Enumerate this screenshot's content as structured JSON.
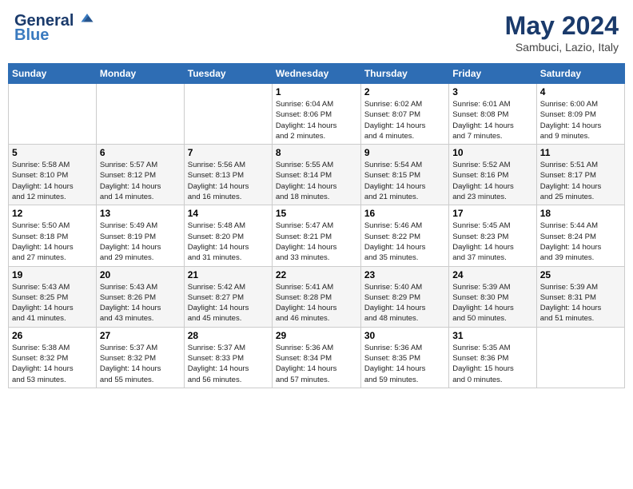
{
  "header": {
    "logo_line1": "General",
    "logo_line2": "Blue",
    "month_title": "May 2024",
    "location": "Sambuci, Lazio, Italy"
  },
  "days_of_week": [
    "Sunday",
    "Monday",
    "Tuesday",
    "Wednesday",
    "Thursday",
    "Friday",
    "Saturday"
  ],
  "weeks": [
    [
      {
        "num": "",
        "info": ""
      },
      {
        "num": "",
        "info": ""
      },
      {
        "num": "",
        "info": ""
      },
      {
        "num": "1",
        "info": "Sunrise: 6:04 AM\nSunset: 8:06 PM\nDaylight: 14 hours\nand 2 minutes."
      },
      {
        "num": "2",
        "info": "Sunrise: 6:02 AM\nSunset: 8:07 PM\nDaylight: 14 hours\nand 4 minutes."
      },
      {
        "num": "3",
        "info": "Sunrise: 6:01 AM\nSunset: 8:08 PM\nDaylight: 14 hours\nand 7 minutes."
      },
      {
        "num": "4",
        "info": "Sunrise: 6:00 AM\nSunset: 8:09 PM\nDaylight: 14 hours\nand 9 minutes."
      }
    ],
    [
      {
        "num": "5",
        "info": "Sunrise: 5:58 AM\nSunset: 8:10 PM\nDaylight: 14 hours\nand 12 minutes."
      },
      {
        "num": "6",
        "info": "Sunrise: 5:57 AM\nSunset: 8:12 PM\nDaylight: 14 hours\nand 14 minutes."
      },
      {
        "num": "7",
        "info": "Sunrise: 5:56 AM\nSunset: 8:13 PM\nDaylight: 14 hours\nand 16 minutes."
      },
      {
        "num": "8",
        "info": "Sunrise: 5:55 AM\nSunset: 8:14 PM\nDaylight: 14 hours\nand 18 minutes."
      },
      {
        "num": "9",
        "info": "Sunrise: 5:54 AM\nSunset: 8:15 PM\nDaylight: 14 hours\nand 21 minutes."
      },
      {
        "num": "10",
        "info": "Sunrise: 5:52 AM\nSunset: 8:16 PM\nDaylight: 14 hours\nand 23 minutes."
      },
      {
        "num": "11",
        "info": "Sunrise: 5:51 AM\nSunset: 8:17 PM\nDaylight: 14 hours\nand 25 minutes."
      }
    ],
    [
      {
        "num": "12",
        "info": "Sunrise: 5:50 AM\nSunset: 8:18 PM\nDaylight: 14 hours\nand 27 minutes."
      },
      {
        "num": "13",
        "info": "Sunrise: 5:49 AM\nSunset: 8:19 PM\nDaylight: 14 hours\nand 29 minutes."
      },
      {
        "num": "14",
        "info": "Sunrise: 5:48 AM\nSunset: 8:20 PM\nDaylight: 14 hours\nand 31 minutes."
      },
      {
        "num": "15",
        "info": "Sunrise: 5:47 AM\nSunset: 8:21 PM\nDaylight: 14 hours\nand 33 minutes."
      },
      {
        "num": "16",
        "info": "Sunrise: 5:46 AM\nSunset: 8:22 PM\nDaylight: 14 hours\nand 35 minutes."
      },
      {
        "num": "17",
        "info": "Sunrise: 5:45 AM\nSunset: 8:23 PM\nDaylight: 14 hours\nand 37 minutes."
      },
      {
        "num": "18",
        "info": "Sunrise: 5:44 AM\nSunset: 8:24 PM\nDaylight: 14 hours\nand 39 minutes."
      }
    ],
    [
      {
        "num": "19",
        "info": "Sunrise: 5:43 AM\nSunset: 8:25 PM\nDaylight: 14 hours\nand 41 minutes."
      },
      {
        "num": "20",
        "info": "Sunrise: 5:43 AM\nSunset: 8:26 PM\nDaylight: 14 hours\nand 43 minutes."
      },
      {
        "num": "21",
        "info": "Sunrise: 5:42 AM\nSunset: 8:27 PM\nDaylight: 14 hours\nand 45 minutes."
      },
      {
        "num": "22",
        "info": "Sunrise: 5:41 AM\nSunset: 8:28 PM\nDaylight: 14 hours\nand 46 minutes."
      },
      {
        "num": "23",
        "info": "Sunrise: 5:40 AM\nSunset: 8:29 PM\nDaylight: 14 hours\nand 48 minutes."
      },
      {
        "num": "24",
        "info": "Sunrise: 5:39 AM\nSunset: 8:30 PM\nDaylight: 14 hours\nand 50 minutes."
      },
      {
        "num": "25",
        "info": "Sunrise: 5:39 AM\nSunset: 8:31 PM\nDaylight: 14 hours\nand 51 minutes."
      }
    ],
    [
      {
        "num": "26",
        "info": "Sunrise: 5:38 AM\nSunset: 8:32 PM\nDaylight: 14 hours\nand 53 minutes."
      },
      {
        "num": "27",
        "info": "Sunrise: 5:37 AM\nSunset: 8:32 PM\nDaylight: 14 hours\nand 55 minutes."
      },
      {
        "num": "28",
        "info": "Sunrise: 5:37 AM\nSunset: 8:33 PM\nDaylight: 14 hours\nand 56 minutes."
      },
      {
        "num": "29",
        "info": "Sunrise: 5:36 AM\nSunset: 8:34 PM\nDaylight: 14 hours\nand 57 minutes."
      },
      {
        "num": "30",
        "info": "Sunrise: 5:36 AM\nSunset: 8:35 PM\nDaylight: 14 hours\nand 59 minutes."
      },
      {
        "num": "31",
        "info": "Sunrise: 5:35 AM\nSunset: 8:36 PM\nDaylight: 15 hours\nand 0 minutes."
      },
      {
        "num": "",
        "info": ""
      }
    ]
  ]
}
